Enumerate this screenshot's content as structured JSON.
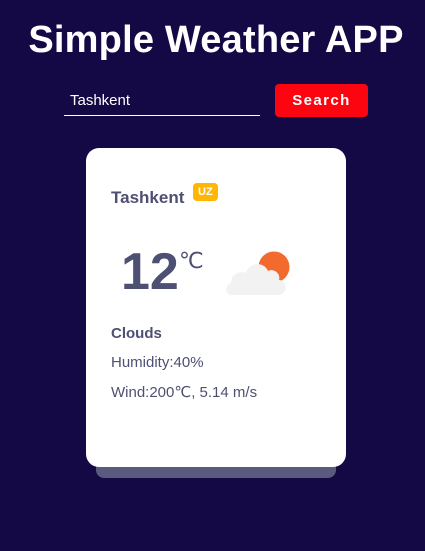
{
  "app": {
    "title": "Simple Weather APP"
  },
  "search": {
    "value": "Tashkent",
    "button_label": "Search"
  },
  "weather": {
    "city": "Tashkent",
    "country": "UZ",
    "temperature": "12",
    "unit": "℃",
    "condition": "Clouds",
    "icon": "partly-cloudy-icon",
    "humidity": "Humidity:40%",
    "wind": "Wind:200℃, 5.14 m/s"
  },
  "colors": {
    "background": "#150945",
    "accent": "#fc0510",
    "badge": "#ffb703",
    "text": "#4e5073",
    "sun": "#f26a2d"
  }
}
